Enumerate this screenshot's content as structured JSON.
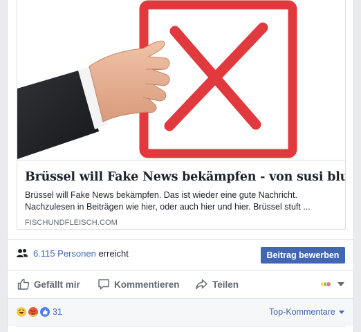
{
  "link_card": {
    "title": "Brüssel will Fake News bekämpfen - von susi blue",
    "description": "Brüssel will Fake News bekämpfen. Das ist wieder eine gute Nachricht. Nachzulesen in Beiträgen wie hier, oder auch hier und hier. Brüssel stuft ...",
    "domain": "FISCHUNDFLEISCH.COM",
    "image_icon": "hand-holding-red-x-checkbox"
  },
  "reach": {
    "icon": "people-icon",
    "count": "6.115 Personen",
    "suffix": "erreicht",
    "boost_label": "Beitrag bewerben"
  },
  "actions": {
    "like": "Gefällt mir",
    "comment": "Kommentieren",
    "share": "Teilen"
  },
  "reactions": {
    "icons": [
      "haha",
      "angry",
      "like"
    ],
    "count": "31",
    "sort_label": "Top-Kommentare"
  },
  "colors": {
    "link_blue": "#4267b2",
    "gray_text": "#606770",
    "red_box": "#e03a3e"
  }
}
